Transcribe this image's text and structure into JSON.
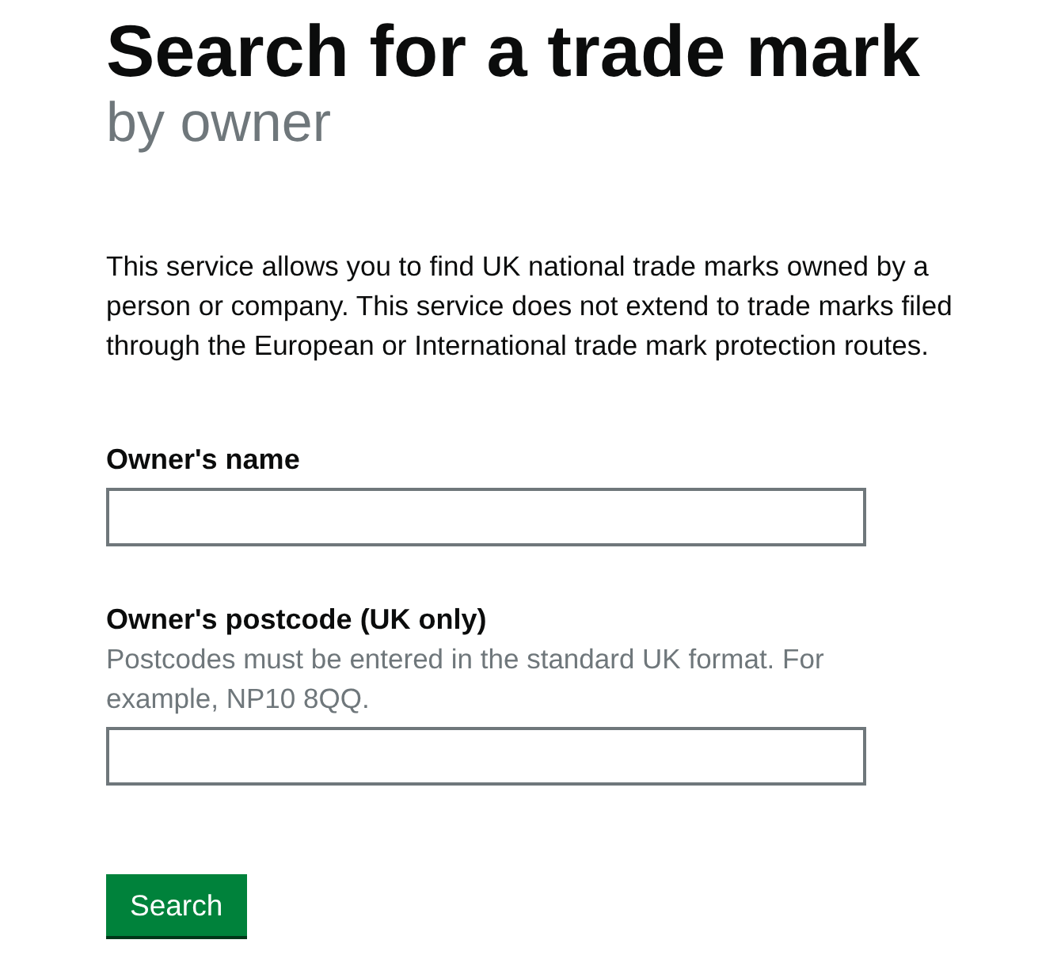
{
  "heading": {
    "title": "Search for a trade mark",
    "subtitle": "by owner"
  },
  "intro": "This service allows you to find UK national trade marks owned by a person or company. This service does not extend to trade marks filed through the European or International trade mark protection routes.",
  "fields": [
    {
      "label": "Owner's name"
    },
    {
      "label": "Owner's postcode (UK only)",
      "hint": "Postcodes must be entered in the standard UK format. For example, NP10 8QQ."
    }
  ],
  "buttons": [
    "Search"
  ]
}
